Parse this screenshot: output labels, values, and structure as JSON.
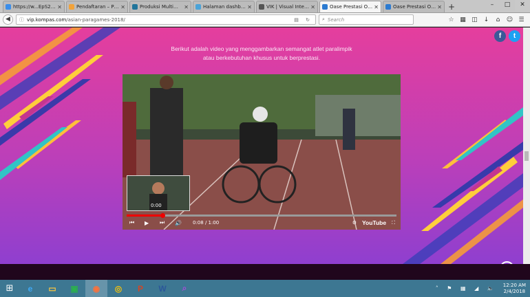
{
  "browser": {
    "tabs": [
      {
        "title": "https://w...EpS27pil",
        "favicon_color": "#3b8eea",
        "active": false
      },
      {
        "title": "Pendaftaran – Pus...",
        "favicon_color": "#f2a33a",
        "active": false
      },
      {
        "title": "Produksi Multime...",
        "favicon_color": "#21759b",
        "active": false
      },
      {
        "title": "Halaman dashboa...",
        "favicon_color": "#4aa3d8",
        "active": false
      },
      {
        "title": "VIK | Visual Interaktif K...",
        "favicon_color": "#555555",
        "active": false
      },
      {
        "title": "Oase Prestasi Ola...",
        "favicon_color": "#2c7bd1",
        "active": true
      },
      {
        "title": "Oase Prestasi Ola...",
        "favicon_color": "#2c7bd1",
        "active": false
      }
    ],
    "new_tab_label": "+",
    "window_controls": {
      "minimize": "–",
      "maximize": "□",
      "close": "✕"
    },
    "url_domain": "vip.kompas.com",
    "url_path": "/asian-paragames-2018/",
    "search_placeholder": "Search"
  },
  "page": {
    "intro_line1": "Berikut adalah video yang menggambarkan semangat atlet paralimpik",
    "intro_line2": "atau berkebutuhan khusus untuk berprestasi.",
    "social": {
      "facebook": "f",
      "twitter": "t"
    },
    "video": {
      "preview_time": "0:00",
      "current_time": "0:08",
      "duration": "1:00",
      "time_display": "0:08 / 1:00",
      "progress_fraction": 0.133,
      "logo": "YouTube"
    },
    "scroll_top_label": "^"
  },
  "taskbar": {
    "apps": [
      {
        "name": "internet-explorer",
        "glyph": "e",
        "color": "#3fa9f5",
        "open": false
      },
      {
        "name": "file-explorer",
        "glyph": "▭",
        "color": "#f5c342",
        "open": false
      },
      {
        "name": "store",
        "glyph": "▣",
        "color": "#2bb24c",
        "open": false
      },
      {
        "name": "firefox",
        "glyph": "◉",
        "color": "#ff7139",
        "open": true
      },
      {
        "name": "chrome",
        "glyph": "◎",
        "color": "#f4c20d",
        "open": false
      },
      {
        "name": "powerpoint",
        "glyph": "P",
        "color": "#d24726",
        "open": false
      },
      {
        "name": "word",
        "glyph": "W",
        "color": "#2b579a",
        "open": false
      },
      {
        "name": "search-app",
        "glyph": "⌕",
        "color": "#a34fd8",
        "open": false
      }
    ],
    "time": "12:20 AM",
    "date": "2/4/2018"
  },
  "colors": {
    "accent_pink": "#e53e9d",
    "accent_purple": "#8f3fcf",
    "youtube_red": "#e00000"
  }
}
